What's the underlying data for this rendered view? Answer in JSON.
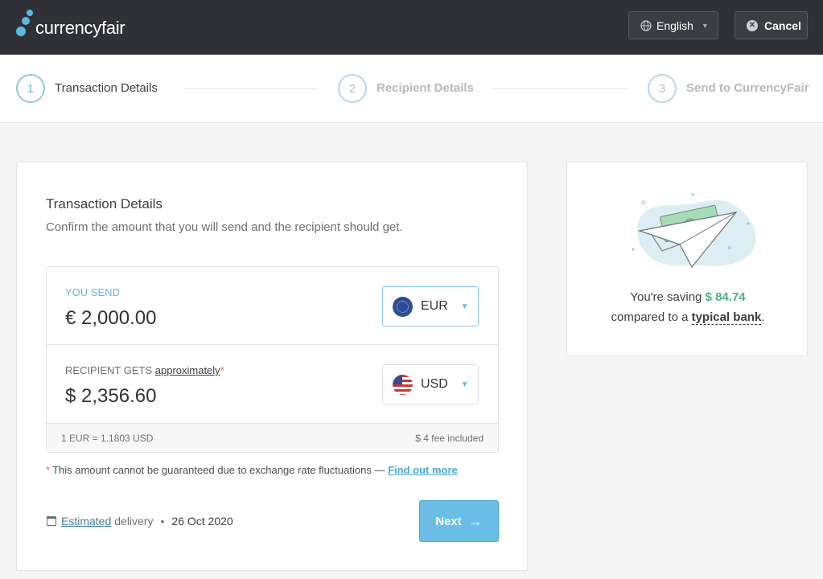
{
  "header": {
    "brand": "currencyfair",
    "language_label": "English",
    "cancel_label": "Cancel"
  },
  "steps": [
    {
      "number": "1",
      "label": "Transaction Details",
      "active": true
    },
    {
      "number": "2",
      "label": "Recipient Details",
      "active": false
    },
    {
      "number": "3",
      "label": "Send to CurrencyFair",
      "active": false
    }
  ],
  "transaction": {
    "title": "Transaction Details",
    "subtitle": "Confirm the amount that you will send and the recipient should get.",
    "send": {
      "label": "YOU SEND",
      "amount": "€ 2,000.00",
      "currency": "EUR"
    },
    "get": {
      "label": "RECIPIENT GETS",
      "approx_label": "approximately",
      "star": "*",
      "amount": "$ 2,356.60",
      "currency": "USD"
    },
    "rate": "1 EUR = 1.1803 USD",
    "fee": "$ 4 fee included",
    "disclaimer": {
      "star": "*",
      "text": "This amount cannot be guaranteed due to exchange rate fluctuations —",
      "link": "Find out more"
    },
    "delivery": {
      "estimated": "Estimated",
      "label": "delivery",
      "separator": "•",
      "date": "26 Oct 2020"
    },
    "next_label": "Next"
  },
  "savings": {
    "prefix": "You're saving",
    "amount": "$ 84.74",
    "line2_prefix": "compared to a",
    "typical_bank": "typical bank",
    "suffix": "."
  },
  "colors": {
    "header_bg": "#2f3136",
    "accent": "#69bde6",
    "saving_green": "#4db07a",
    "warning_star": "#e8603c"
  }
}
